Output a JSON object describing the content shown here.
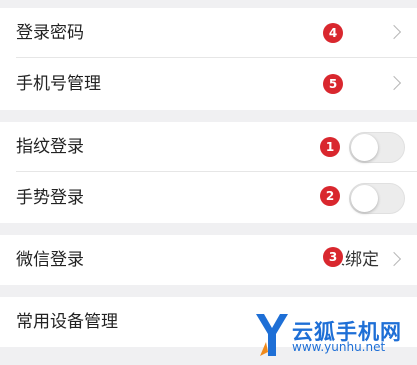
{
  "group1": {
    "login_password": {
      "label": "登录密码",
      "badge": "4"
    },
    "phone_manage": {
      "label": "手机号管理",
      "badge": "5"
    }
  },
  "group2": {
    "fingerprint": {
      "label": "指纹登录",
      "badge": "1",
      "enabled": false
    },
    "gesture": {
      "label": "手势登录",
      "badge": "2",
      "enabled": false
    }
  },
  "group3": {
    "wechat": {
      "label": "微信登录",
      "value": "未绑定",
      "badge": "3"
    }
  },
  "group4": {
    "devices": {
      "label": "常用设备管理"
    }
  },
  "watermark": {
    "brand": "云狐手机网",
    "url": "www.yunhu.net"
  },
  "colors": {
    "badge": "#d9272e",
    "watermark": "#1e6fd6"
  },
  "icons": [
    "chevron-right-icon",
    "toggle-switch"
  ]
}
